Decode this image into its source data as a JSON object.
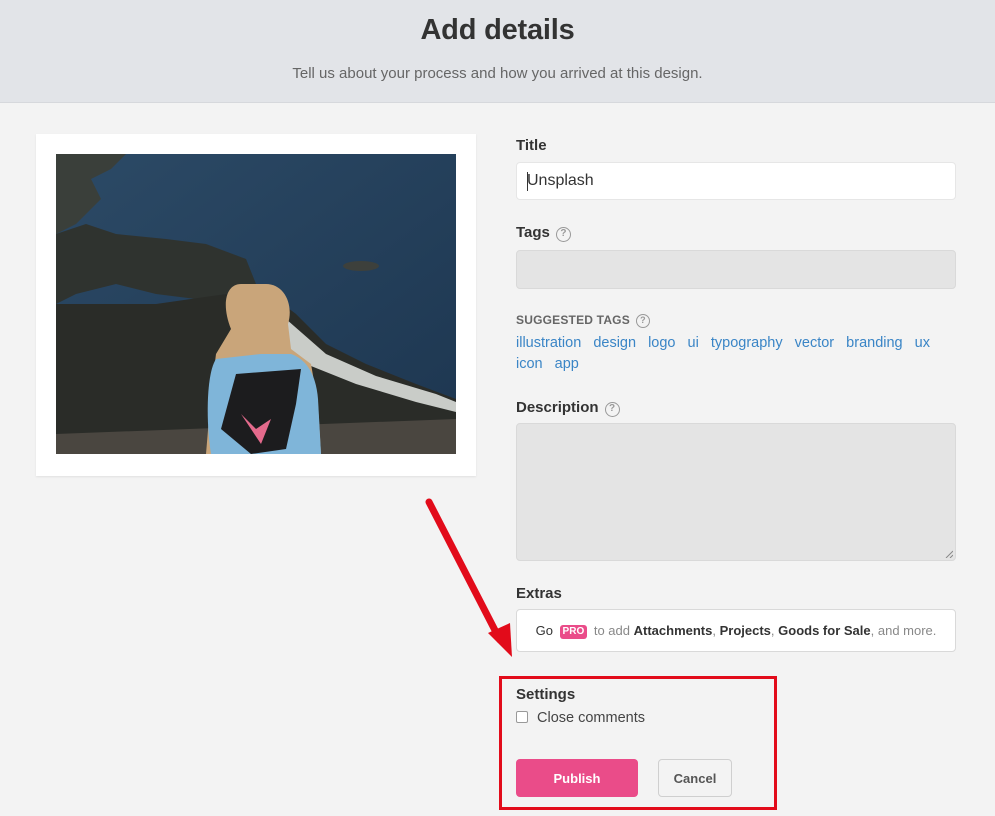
{
  "header": {
    "title": "Add details",
    "subtitle": "Tell us about your process and how you arrived at this design."
  },
  "form": {
    "title_label": "Title",
    "title_value": "Unsplash",
    "tags_label": "Tags",
    "help_glyph": "?",
    "suggested_label": "SUGGESTED TAGS",
    "suggested_tags": [
      "illustration",
      "design",
      "logo",
      "ui",
      "typography",
      "vector",
      "branding",
      "ux",
      "icon",
      "app"
    ],
    "description_label": "Description",
    "extras_label": "Extras",
    "extras": {
      "go": "Go",
      "badge": "PRO",
      "to_add": "to add",
      "attachments": "Attachments",
      "projects": "Projects",
      "goods": "Goods for Sale",
      "and_more": "and more."
    },
    "settings_label": "Settings",
    "close_comments_label": "Close comments",
    "close_comments_checked": false,
    "publish_label": "Publish",
    "cancel_label": "Cancel"
  },
  "colors": {
    "accent": "#ea4c89",
    "link": "#3a85c6",
    "annotation": "#e20b1a"
  }
}
